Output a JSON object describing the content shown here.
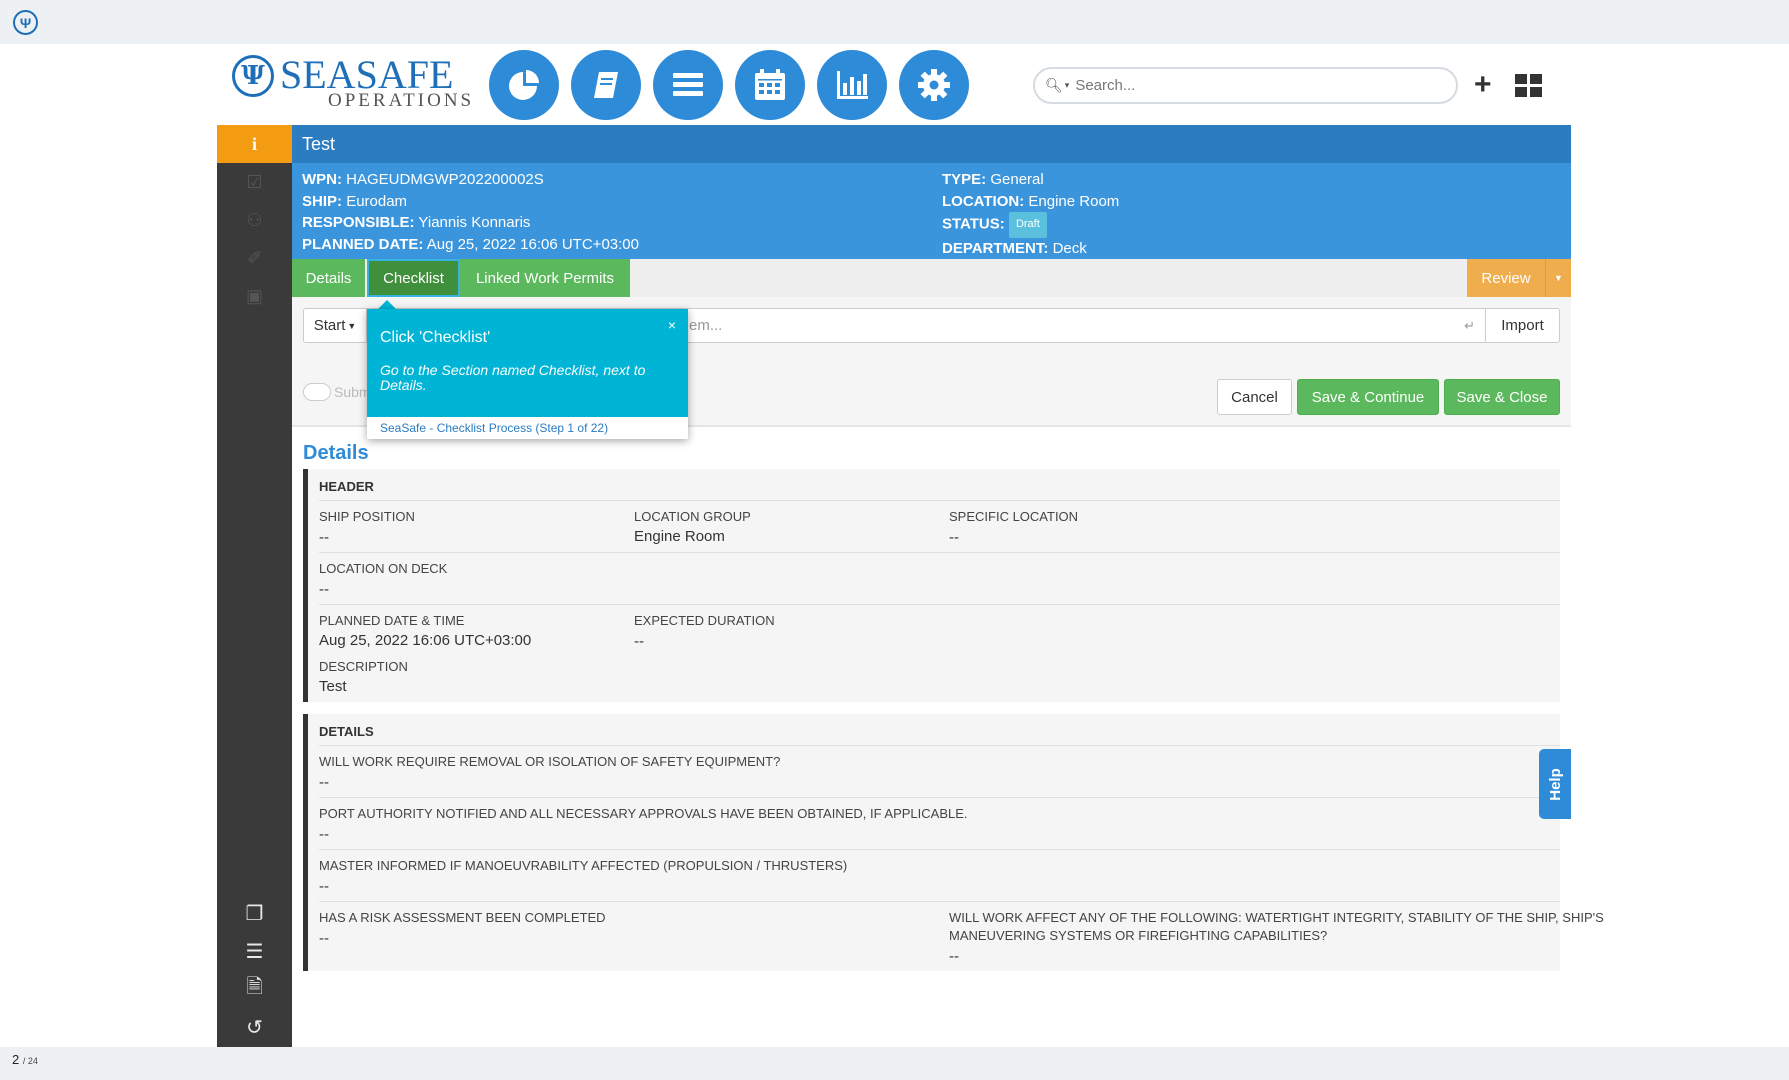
{
  "page_counter": {
    "current": "2",
    "total": "/ 24"
  },
  "brand": {
    "emblem": "Ψ",
    "name": "SEASAFE",
    "sub": "OPERATIONS"
  },
  "search": {
    "placeholder": "Search..."
  },
  "header_actions": {
    "plus": "+"
  },
  "sidebar": {
    "info_glyph": "i"
  },
  "panel": {
    "title": "Test",
    "left_fields": [
      {
        "label": "WPN:",
        "value": "HAGEUDMGWP202200002S"
      },
      {
        "label": "SHIP:",
        "value": "Eurodam"
      },
      {
        "label": "RESPONSIBLE:",
        "value": "Yiannis Konnaris"
      },
      {
        "label": "PLANNED DATE:",
        "value": "Aug 25, 2022 16:06 UTC+03:00"
      }
    ],
    "right_fields": [
      {
        "label": "TYPE:",
        "value": "General"
      },
      {
        "label": "LOCATION:",
        "value": "Engine Room"
      },
      {
        "label": "STATUS:",
        "value": "Draft"
      },
      {
        "label": "DEPARTMENT:",
        "value": "Deck"
      }
    ]
  },
  "tabs": [
    {
      "label": "Details"
    },
    {
      "label": "Checklist"
    },
    {
      "label": "Linked Work Permits"
    }
  ],
  "review": {
    "label": "Review"
  },
  "toolbar": {
    "start_label": "Start",
    "item_placeholder_visible": "em...",
    "enter_glyph": "↵",
    "import_label": "Import",
    "toggle_label": "Subm",
    "cancel_label": "Cancel",
    "save_continue_label": "Save & Continue",
    "save_close_label": "Save & Close"
  },
  "tooltip": {
    "title": "Click 'Checklist'",
    "close": "×",
    "text": "Go to the Section named Checklist, next to Details.",
    "footer": "SeaSafe - Checklist Process (Step 1 of 22)"
  },
  "details": {
    "title": "Details",
    "header_section": {
      "heading": "HEADER",
      "ship_position": {
        "label": "SHIP POSITION",
        "value": "--"
      },
      "location_group": {
        "label": "LOCATION GROUP",
        "value": "Engine Room"
      },
      "specific_location": {
        "label": "SPECIFIC LOCATION",
        "value": "--"
      },
      "location_on_deck": {
        "label": "LOCATION ON DECK",
        "value": "--"
      },
      "planned_date_time": {
        "label": "PLANNED DATE & TIME",
        "value": "Aug 25, 2022 16:06 UTC+03:00"
      },
      "expected_duration": {
        "label": "EXPECTED DURATION",
        "value": "--"
      },
      "description": {
        "label": "DESCRIPTION",
        "value": "Test"
      }
    },
    "details_section": {
      "heading": "DETAILS",
      "q1": {
        "label": "WILL WORK REQUIRE REMOVAL OR ISOLATION OF SAFETY EQUIPMENT?",
        "value": "--"
      },
      "q2": {
        "label": "PORT AUTHORITY NOTIFIED AND ALL NECESSARY APPROVALS HAVE BEEN OBTAINED, IF APPLICABLE.",
        "value": "--"
      },
      "q3": {
        "label": "MASTER INFORMED IF MANOEUVRABILITY AFFECTED (PROPULSION / THRUSTERS)",
        "value": "--"
      },
      "q4": {
        "label": "HAS A RISK ASSESSMENT BEEN COMPLETED",
        "value": "--"
      },
      "q5": {
        "label_line1": "WILL WORK AFFECT ANY OF THE FOLLOWING: WATERTIGHT INTEGRITY, STABILITY OF THE SHIP, SHIP'S",
        "label_line2": "MANEUVERING SYSTEMS OR FIREFIGHTING CAPABILITIES?",
        "value": "--"
      }
    }
  },
  "help": {
    "label": "Help"
  },
  "colors": {
    "brand_blue": "#1e6fb8",
    "nav_blue": "#2e8bd8",
    "title_bar": "#2b7cc1",
    "info_band": "#3a95dd",
    "tab_green": "#5cb85c",
    "review_orange": "#f0ad4e",
    "tooltip_cyan": "#00b4d6",
    "sidebar_dark": "#3a3a3a"
  }
}
